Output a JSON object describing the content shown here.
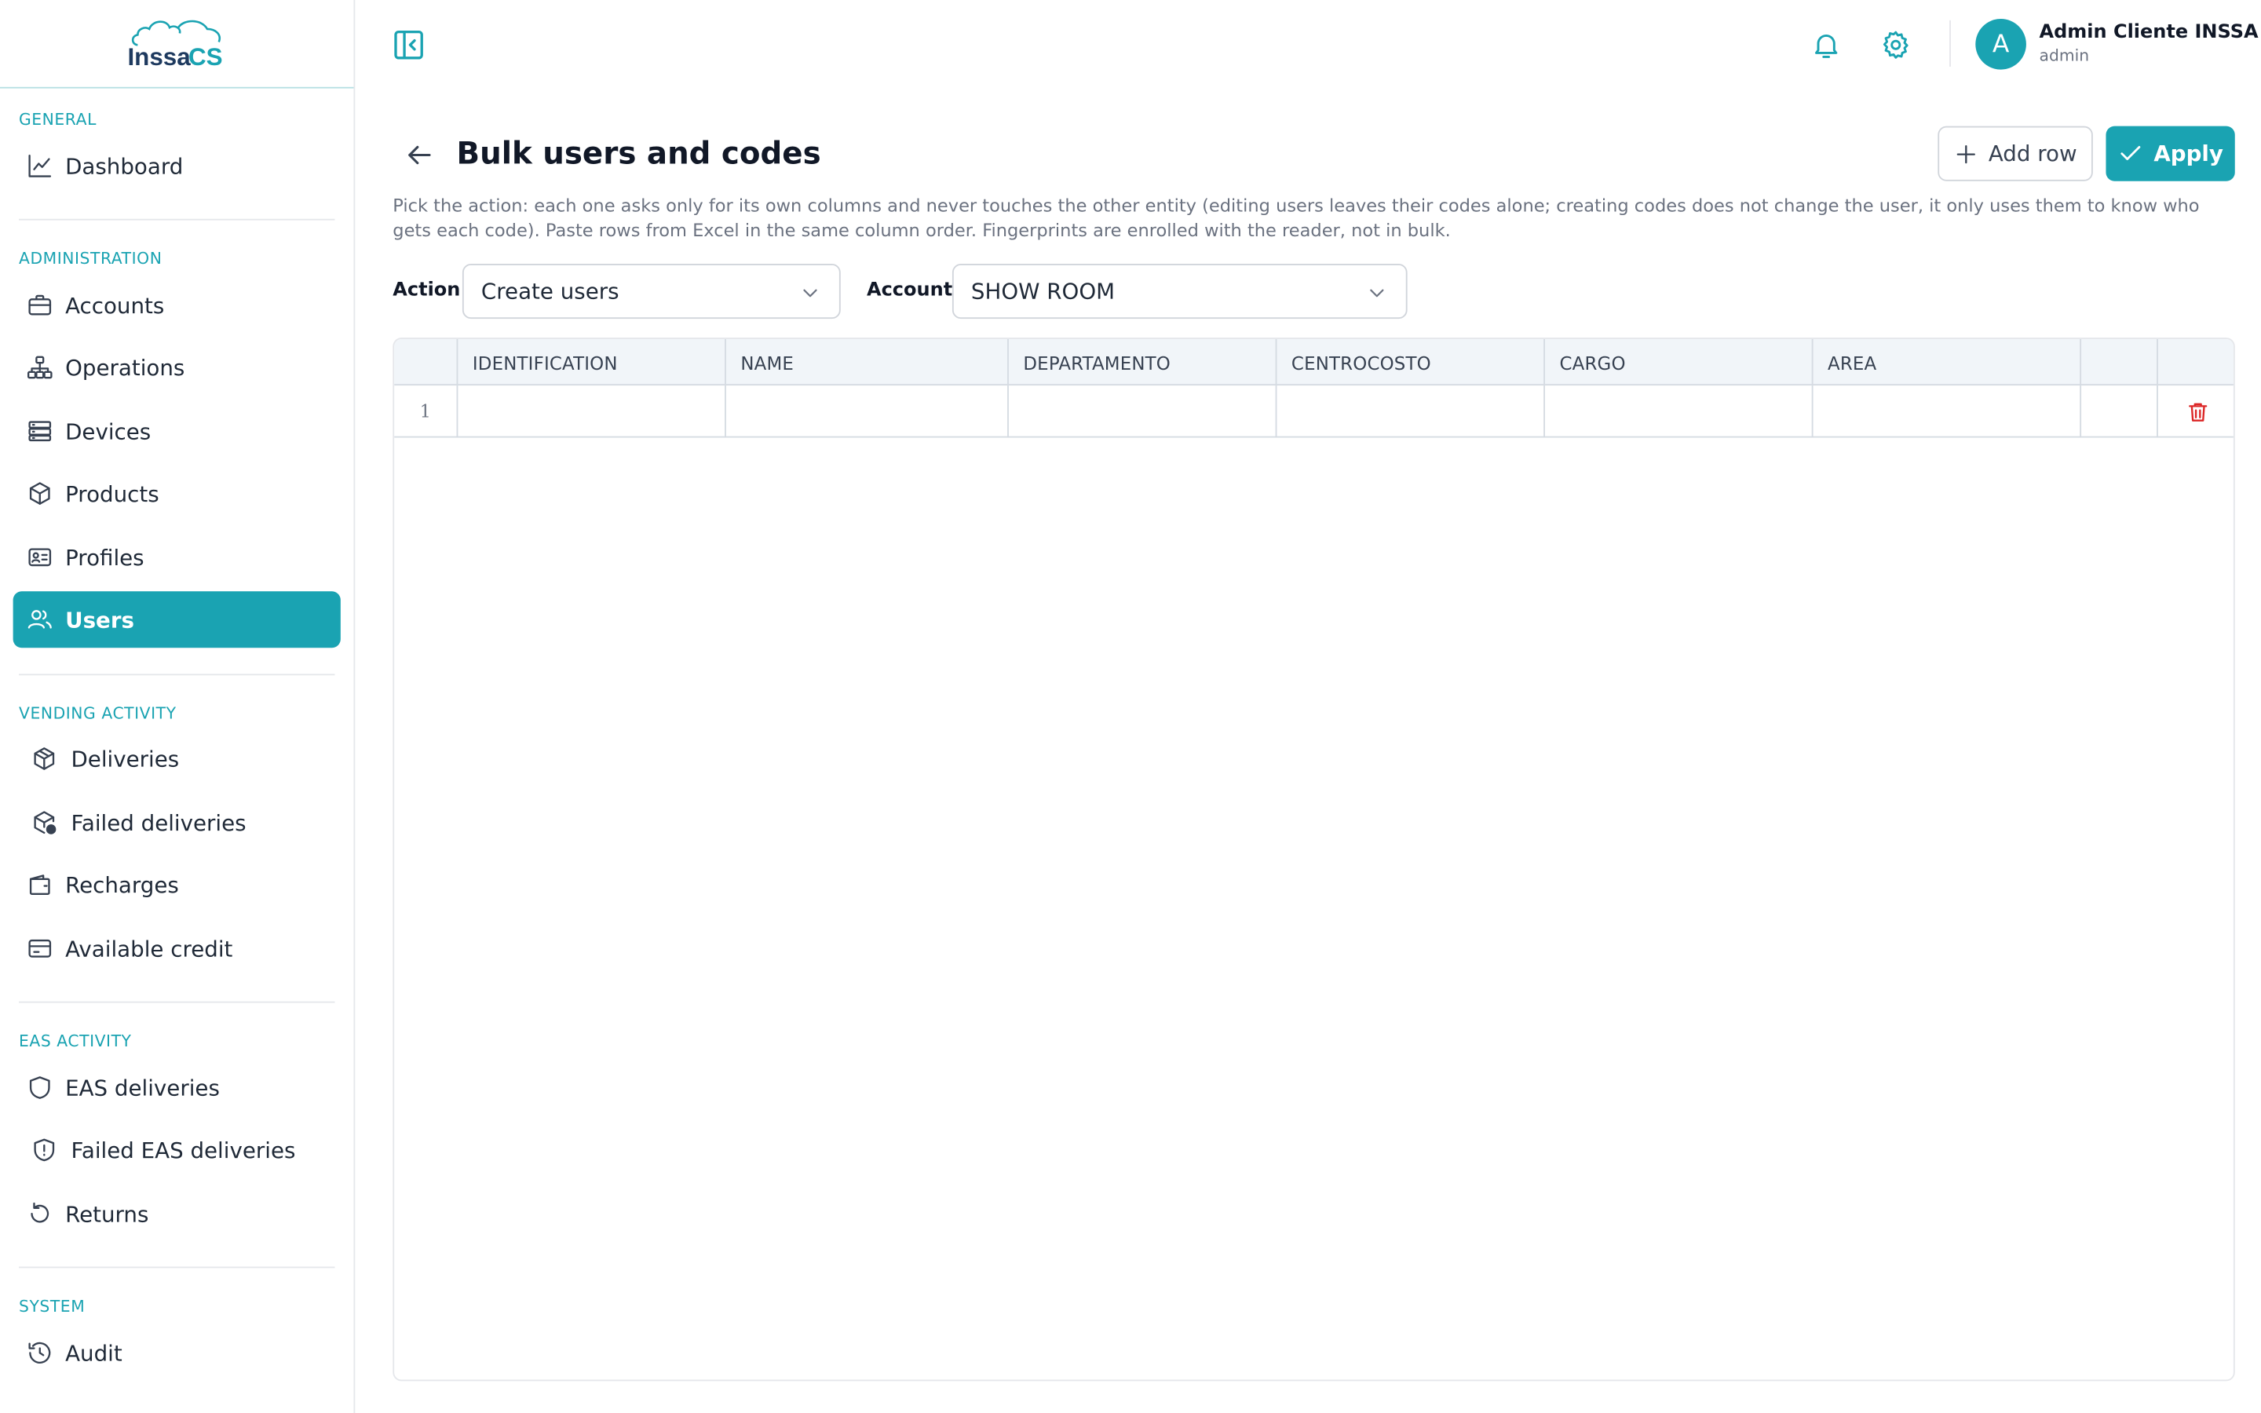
{
  "app": {
    "logo_text_left": "Inssa",
    "logo_text_right": "CS"
  },
  "colors": {
    "accent": "#1aa3b2",
    "danger": "#dc2626"
  },
  "sidebar": {
    "sections": [
      {
        "label": "GENERAL",
        "items": [
          {
            "label": "Dashboard",
            "icon": "chart-line-icon"
          }
        ]
      },
      {
        "label": "ADMINISTRATION",
        "items": [
          {
            "label": "Accounts",
            "icon": "briefcase-icon"
          },
          {
            "label": "Operations",
            "icon": "network-icon"
          },
          {
            "label": "Devices",
            "icon": "server-icon"
          },
          {
            "label": "Products",
            "icon": "box-icon"
          },
          {
            "label": "Profiles",
            "icon": "id-card-icon"
          },
          {
            "label": "Users",
            "icon": "users-icon",
            "active": true
          }
        ]
      },
      {
        "label": "VENDING ACTIVITY",
        "items": [
          {
            "label": "Deliveries",
            "icon": "package-icon"
          },
          {
            "label": "Failed deliveries",
            "icon": "package-alert-icon"
          },
          {
            "label": "Recharges",
            "icon": "wallet-icon"
          },
          {
            "label": "Available credit",
            "icon": "credit-card-icon"
          }
        ]
      },
      {
        "label": "EAS ACTIVITY",
        "items": [
          {
            "label": "EAS deliveries",
            "icon": "shield-icon"
          },
          {
            "label": "Failed EAS deliveries",
            "icon": "shield-alert-icon"
          },
          {
            "label": "Returns",
            "icon": "rotate-icon"
          }
        ]
      },
      {
        "label": "SYSTEM",
        "items": [
          {
            "label": "Audit",
            "icon": "history-icon"
          }
        ]
      }
    ]
  },
  "header": {
    "user": {
      "initial": "A",
      "name": "Admin Cliente INSSA",
      "role": "admin"
    }
  },
  "page": {
    "title": "Bulk users and codes",
    "description": "Pick the action: each one asks only for its own columns and never touches the other entity (editing users leaves their codes alone; creating codes does not change the user, it only uses them to know who gets each code). Paste rows from Excel in the same column order. Fingerprints are enrolled with the reader, not in bulk.",
    "add_row_label": "Add row",
    "apply_label": "Apply",
    "action_label": "Action",
    "action_value": "Create users",
    "account_label": "Account",
    "account_value": "SHOW ROOM"
  },
  "grid": {
    "columns": [
      "IDENTIFICATION",
      "NAME",
      "DEPARTAMENTO",
      "CENTROCOSTO",
      "CARGO",
      "AREA"
    ],
    "rows": [
      {
        "index": "1",
        "cells": [
          "",
          "",
          "",
          "",
          "",
          ""
        ]
      }
    ]
  }
}
